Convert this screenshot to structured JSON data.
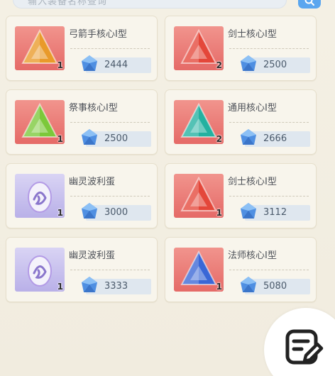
{
  "search": {
    "placeholder": "输入装备名称查询",
    "button_icon": "search-icon"
  },
  "shop_items": [
    {
      "name": "弓箭手核心I型",
      "qty": "1",
      "price": "2444",
      "icon": "triangle-core-icon",
      "color": "#e99a2a"
    },
    {
      "name": "剑士核心I型",
      "qty": "2",
      "price": "2500",
      "icon": "triangle-core-icon",
      "color": "#e4473a"
    },
    {
      "name": "祭事核心I型",
      "qty": "1",
      "price": "2500",
      "icon": "triangle-core-icon",
      "color": "#7cc83a"
    },
    {
      "name": "通用核心I型",
      "qty": "2",
      "price": "2666",
      "icon": "triangle-core-icon",
      "color": "#24b1a0"
    },
    {
      "name": "幽灵波利蛋",
      "qty": "1",
      "price": "3000",
      "icon": "ghost-egg-icon",
      "color": "#b39be6"
    },
    {
      "name": "剑士核心I型",
      "qty": "1",
      "price": "3112",
      "icon": "triangle-core-icon",
      "color": "#e4473a"
    },
    {
      "name": "幽灵波利蛋",
      "qty": "1",
      "price": "3333",
      "icon": "ghost-egg-icon",
      "color": "#b39be6"
    },
    {
      "name": "法师核心I型",
      "qty": "1",
      "price": "5080",
      "icon": "triangle-core-icon",
      "color": "#3a67d6"
    }
  ],
  "currency_icon": "blue-gem-icon",
  "fab": {
    "icon": "edit-note-icon"
  }
}
